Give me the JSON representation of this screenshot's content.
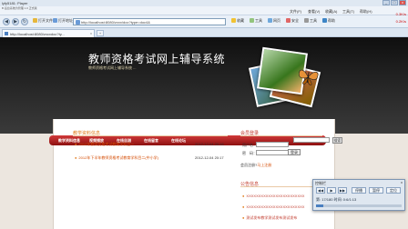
{
  "window": {
    "title": "lyfy5181: Player",
    "subtitle": "B 后台系统为管理 1.0 正式版",
    "buttons": [
      "_",
      "□",
      "x"
    ],
    "net_speed": "0.2K/s"
  },
  "menu": {
    "items": [
      "文件(F)",
      "查看(V)",
      "收藏(A)",
      "工具(T)",
      "帮助(H)"
    ],
    "net_speed": "0.3K/s"
  },
  "nav": {
    "back": "◀",
    "forward": "▶",
    "reload": "↻",
    "address": "http://localhost:8080/zxxx/doc?type=doc4&",
    "left_buttons": [
      "打开文件",
      "打开地址"
    ],
    "toolbar": [
      "收藏",
      "工具",
      "网页",
      "安全",
      "工具",
      "帮助"
    ]
  },
  "tab": {
    "title": "http://localhost:8080/zxcxdoc?ty...",
    "close": "x",
    "new": "+"
  },
  "site": {
    "title": "教师资格考试网上辅导系统",
    "subtitle": "教师资格考试网上辅导系统 ..."
  },
  "mainnav": {
    "links": [
      "教学资料信息",
      "视频播放",
      "在线自测",
      "在线留言",
      "在线论坛"
    ],
    "search_placeholder": "",
    "search_button": "搜索"
  },
  "announcements": {
    "title": "教学资料信息",
    "items": [
      {
        "text": "2012年教师资格考试教育学科目一",
        "date": "2012-12-04 20:16"
      },
      {
        "text": "2012年下半年教师资格考试教育学科目二(中小学)",
        "date": "2012-12-04 20:17"
      }
    ]
  },
  "login": {
    "title": "会员登录",
    "user_label": "用户名：",
    "pass_label": "密　码：",
    "button": "登录",
    "register_prefix": "会员注册?",
    "register_link": "马上注册"
  },
  "notices": {
    "title": "公告信息",
    "items": [
      "XXXXXXXXXXXXXXXXXXXXXXXX",
      "XXXXXXXXXXXXXXXXXXXXXXXX",
      "测试发布教学测试发布测试发布"
    ]
  },
  "player": {
    "title": "控制栏",
    "close": "x",
    "buttons": [
      "◀◀",
      "▶",
      "▶▶",
      "停播",
      "暂停",
      "定位"
    ],
    "info": "第: 17/180  时间: 0:6/1:13",
    "progress": 0.09
  },
  "colors": {
    "header": "#1a1a1a",
    "redbar": "#b22222",
    "accent_orange": "#e07b1a",
    "link_red": "#c0392b"
  }
}
